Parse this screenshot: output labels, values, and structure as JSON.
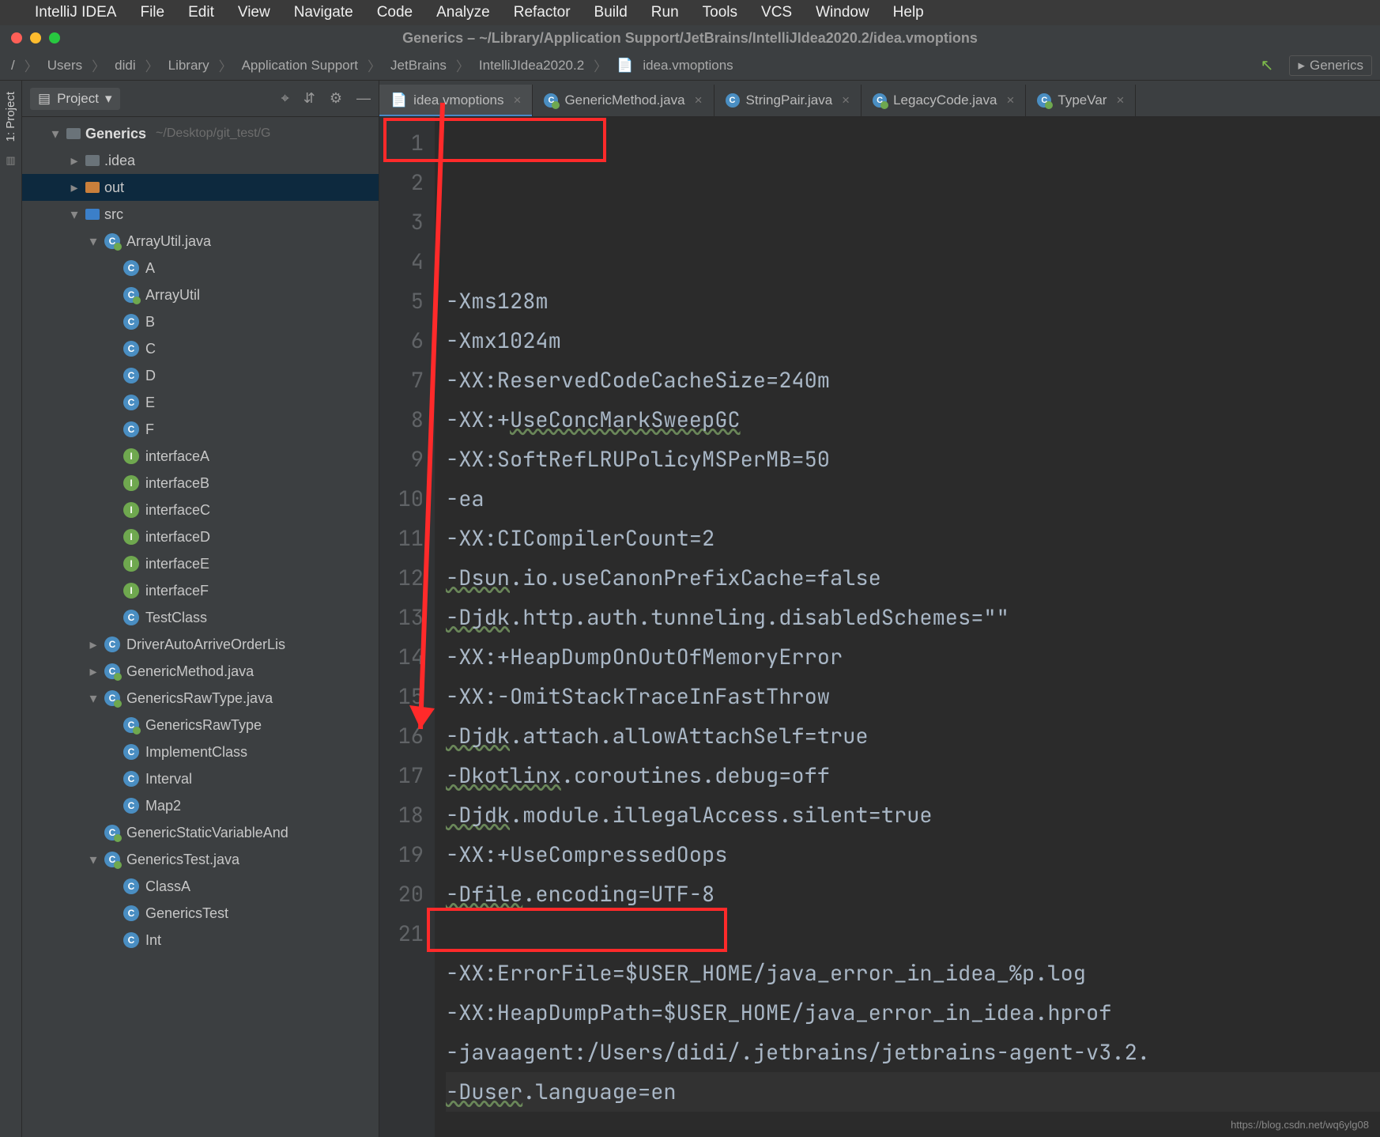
{
  "menubar": {
    "app": "IntelliJ IDEA",
    "items": [
      "File",
      "Edit",
      "View",
      "Navigate",
      "Code",
      "Analyze",
      "Refactor",
      "Build",
      "Run",
      "Tools",
      "VCS",
      "Window",
      "Help"
    ]
  },
  "window": {
    "title": "Generics – ~/Library/Application Support/JetBrains/IntelliJIdea2020.2/idea.vmoptions"
  },
  "breadcrumb": {
    "parts": [
      "/",
      "Users",
      "didi",
      "Library",
      "Application Support",
      "JetBrains",
      "IntelliJIdea2020.2",
      "idea.vmoptions"
    ],
    "run_config": "Generics"
  },
  "sidebar": {
    "title": "Project",
    "vertical_tab": "1: Project",
    "root": {
      "label": "Generics",
      "path": "~/Desktop/git_test/G"
    },
    "tree": [
      {
        "d": 1,
        "arr": ">",
        "kind": "folder",
        "label": ".idea"
      },
      {
        "d": 1,
        "arr": ">",
        "kind": "folder-orange",
        "label": "out",
        "sel": "out"
      },
      {
        "d": 1,
        "arr": "v",
        "kind": "folder-blue",
        "label": "src"
      },
      {
        "d": 2,
        "arr": "v",
        "kind": "j",
        "label": "ArrayUtil.java"
      },
      {
        "d": 3,
        "kind": "c",
        "label": "A"
      },
      {
        "d": 3,
        "kind": "j",
        "label": "ArrayUtil"
      },
      {
        "d": 3,
        "kind": "c",
        "label": "B"
      },
      {
        "d": 3,
        "kind": "c",
        "label": "C"
      },
      {
        "d": 3,
        "kind": "c",
        "label": "D"
      },
      {
        "d": 3,
        "kind": "c",
        "label": "E"
      },
      {
        "d": 3,
        "kind": "c",
        "label": "F"
      },
      {
        "d": 3,
        "kind": "i",
        "label": "interfaceA"
      },
      {
        "d": 3,
        "kind": "i",
        "label": "interfaceB"
      },
      {
        "d": 3,
        "kind": "i",
        "label": "interfaceC"
      },
      {
        "d": 3,
        "kind": "i",
        "label": "interfaceD"
      },
      {
        "d": 3,
        "kind": "i",
        "label": "interfaceE"
      },
      {
        "d": 3,
        "kind": "i",
        "label": "interfaceF"
      },
      {
        "d": 3,
        "kind": "c",
        "label": "TestClass"
      },
      {
        "d": 2,
        "arr": ">",
        "kind": "c",
        "label": "DriverAutoArriveOrderLis"
      },
      {
        "d": 2,
        "arr": ">",
        "kind": "j",
        "label": "GenericMethod.java"
      },
      {
        "d": 2,
        "arr": "v",
        "kind": "j",
        "label": "GenericsRawType.java"
      },
      {
        "d": 3,
        "kind": "j",
        "label": "GenericsRawType"
      },
      {
        "d": 3,
        "kind": "c",
        "label": "ImplementClass"
      },
      {
        "d": 3,
        "kind": "c",
        "label": "Interval"
      },
      {
        "d": 3,
        "kind": "c",
        "label": "Map2"
      },
      {
        "d": 2,
        "kind": "j",
        "label": "GenericStaticVariableAnd"
      },
      {
        "d": 2,
        "arr": "v",
        "kind": "j",
        "label": "GenericsTest.java"
      },
      {
        "d": 3,
        "kind": "c",
        "label": "ClassA"
      },
      {
        "d": 3,
        "kind": "c",
        "label": "GenericsTest"
      },
      {
        "d": 3,
        "kind": "c",
        "label": "Int"
      }
    ]
  },
  "tabs": [
    {
      "label": "idea.vmoptions",
      "icon": "file",
      "active": true
    },
    {
      "label": "GenericMethod.java",
      "icon": "j"
    },
    {
      "label": "StringPair.java",
      "icon": "c"
    },
    {
      "label": "LegacyCode.java",
      "icon": "j"
    },
    {
      "label": "TypeVar",
      "icon": "j"
    }
  ],
  "editor": {
    "lines": [
      "-Xms128m",
      "-Xmx1024m",
      "-XX:ReservedCodeCacheSize=240m",
      "-XX:+UseConcMarkSweepGC",
      "-XX:SoftRefLRUPolicyMSPerMB=50",
      "-ea",
      "-XX:CICompilerCount=2",
      "-Dsun.io.useCanonPrefixCache=false",
      "-Djdk.http.auth.tunneling.disabledSchemes=\"\"",
      "-XX:+HeapDumpOnOutOfMemoryError",
      "-XX:-OmitStackTraceInFastThrow",
      "-Djdk.attach.allowAttachSelf=true",
      "-Dkotlinx.coroutines.debug=off",
      "-Djdk.module.illegalAccess.silent=true",
      "-XX:+UseCompressedOops",
      "-Dfile.encoding=UTF-8",
      "",
      "-XX:ErrorFile=$USER_HOME/java_error_in_idea_%p.log",
      "-XX:HeapDumpPath=$USER_HOME/java_error_in_idea.hprof",
      "-javaagent:/Users/didi/.jetbrains/jetbrains-agent-v3.2.",
      "-Duser.language=en"
    ]
  },
  "watermark": "https://blog.csdn.net/wq6ylg08"
}
